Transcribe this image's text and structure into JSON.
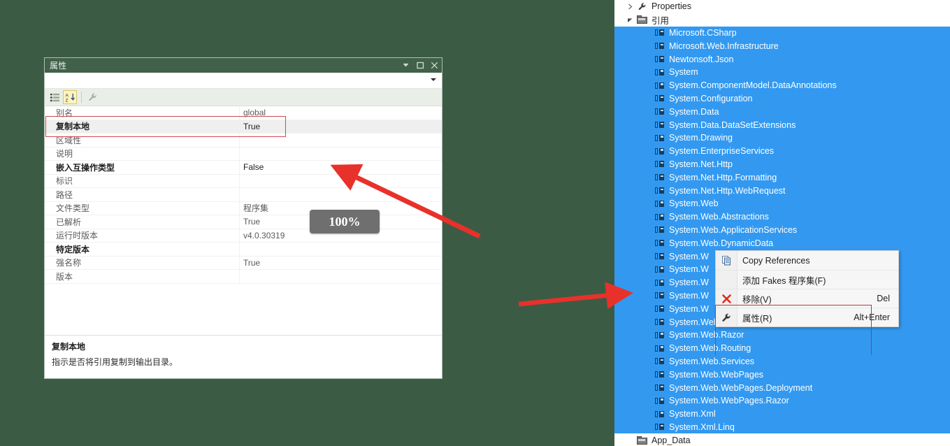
{
  "desktop": {
    "background": "#3c5b45"
  },
  "properties_window": {
    "title": "属性",
    "titlebar_buttons": [
      {
        "name": "dropdown",
        "glyph": "▾"
      },
      {
        "name": "maximize",
        "glyph": "❐"
      },
      {
        "name": "close",
        "glyph": "✕"
      }
    ],
    "toolbar": {
      "categorized_label": "按分类顺序",
      "alphabetical_label": "按字母顺序",
      "property_pages_label": "属性页"
    },
    "grid": {
      "rows": [
        {
          "name": "别名",
          "value": "global",
          "bold": false,
          "selected": false
        },
        {
          "name": "复制本地",
          "value": "True",
          "bold": true,
          "selected": true
        },
        {
          "name": "区域性",
          "value": "",
          "bold": false,
          "selected": false
        },
        {
          "name": "说明",
          "value": "",
          "bold": false,
          "selected": false
        },
        {
          "name": "嵌入互操作类型",
          "value": "False",
          "bold": true,
          "selected": false
        },
        {
          "name": "标识",
          "value": "",
          "bold": false,
          "selected": false
        },
        {
          "name": "路径",
          "value": "",
          "bold": false,
          "selected": false
        },
        {
          "name": "文件类型",
          "value": "程序集",
          "bold": false,
          "selected": false
        },
        {
          "name": "已解析",
          "value": "True",
          "bold": false,
          "selected": false
        },
        {
          "name": "运行时版本",
          "value": "v4.0.30319",
          "bold": false,
          "selected": false
        },
        {
          "name": "特定版本",
          "value": "",
          "bold": true,
          "selected": false
        },
        {
          "name": "强名称",
          "value": "True",
          "bold": false,
          "selected": false
        },
        {
          "name": "版本",
          "value": "",
          "bold": false,
          "selected": false
        }
      ]
    },
    "description": {
      "title": "复制本地",
      "body": "指示是否将引用复制到输出目录。"
    }
  },
  "solution_tree": {
    "nodes": [
      {
        "label": "Properties",
        "level": 1,
        "icon": "wrench-icon",
        "expander": "collapsed",
        "selected": false
      },
      {
        "label": "引用",
        "level": 1,
        "icon": "folder-icon",
        "expander": "expanded",
        "selected": false
      },
      {
        "label": "Microsoft.CSharp",
        "level": 2,
        "icon": "assembly-icon",
        "expander": "none",
        "selected": true
      },
      {
        "label": "Microsoft.Web.Infrastructure",
        "level": 2,
        "icon": "assembly-icon",
        "expander": "none",
        "selected": true
      },
      {
        "label": "Newtonsoft.Json",
        "level": 2,
        "icon": "assembly-icon",
        "expander": "none",
        "selected": true
      },
      {
        "label": "System",
        "level": 2,
        "icon": "assembly-icon",
        "expander": "none",
        "selected": true
      },
      {
        "label": "System.ComponentModel.DataAnnotations",
        "level": 2,
        "icon": "assembly-icon",
        "expander": "none",
        "selected": true
      },
      {
        "label": "System.Configuration",
        "level": 2,
        "icon": "assembly-icon",
        "expander": "none",
        "selected": true
      },
      {
        "label": "System.Data",
        "level": 2,
        "icon": "assembly-icon",
        "expander": "none",
        "selected": true
      },
      {
        "label": "System.Data.DataSetExtensions",
        "level": 2,
        "icon": "assembly-icon",
        "expander": "none",
        "selected": true
      },
      {
        "label": "System.Drawing",
        "level": 2,
        "icon": "assembly-icon",
        "expander": "none",
        "selected": true
      },
      {
        "label": "System.EnterpriseServices",
        "level": 2,
        "icon": "assembly-icon",
        "expander": "none",
        "selected": true
      },
      {
        "label": "System.Net.Http",
        "level": 2,
        "icon": "assembly-icon",
        "expander": "none",
        "selected": true
      },
      {
        "label": "System.Net.Http.Formatting",
        "level": 2,
        "icon": "assembly-icon",
        "expander": "none",
        "selected": true
      },
      {
        "label": "System.Net.Http.WebRequest",
        "level": 2,
        "icon": "assembly-icon",
        "expander": "none",
        "selected": true
      },
      {
        "label": "System.Web",
        "level": 2,
        "icon": "assembly-icon",
        "expander": "none",
        "selected": true
      },
      {
        "label": "System.Web.Abstractions",
        "level": 2,
        "icon": "assembly-icon",
        "expander": "none",
        "selected": true
      },
      {
        "label": "System.Web.ApplicationServices",
        "level": 2,
        "icon": "assembly-icon",
        "expander": "none",
        "selected": true
      },
      {
        "label": "System.Web.DynamicData",
        "level": 2,
        "icon": "assembly-icon",
        "expander": "none",
        "selected": true
      },
      {
        "label": "System.W",
        "level": 2,
        "icon": "assembly-icon",
        "expander": "none",
        "selected": true
      },
      {
        "label": "System.W",
        "level": 2,
        "icon": "assembly-icon",
        "expander": "none",
        "selected": true
      },
      {
        "label": "System.W",
        "level": 2,
        "icon": "assembly-icon",
        "expander": "none",
        "selected": true
      },
      {
        "label": "System.W",
        "level": 2,
        "icon": "assembly-icon",
        "expander": "none",
        "selected": true
      },
      {
        "label": "System.W",
        "level": 2,
        "icon": "assembly-icon",
        "expander": "none",
        "selected": true
      },
      {
        "label": "System.Web.Mvc",
        "level": 2,
        "icon": "assembly-icon",
        "expander": "none",
        "selected": true
      },
      {
        "label": "System.Web.Razor",
        "level": 2,
        "icon": "assembly-icon",
        "expander": "none",
        "selected": true
      },
      {
        "label": "System.Web.Routing",
        "level": 2,
        "icon": "assembly-icon",
        "expander": "none",
        "selected": true
      },
      {
        "label": "System.Web.Services",
        "level": 2,
        "icon": "assembly-icon",
        "expander": "none",
        "selected": true
      },
      {
        "label": "System.Web.WebPages",
        "level": 2,
        "icon": "assembly-icon",
        "expander": "none",
        "selected": true
      },
      {
        "label": "System.Web.WebPages.Deployment",
        "level": 2,
        "icon": "assembly-icon",
        "expander": "none",
        "selected": true
      },
      {
        "label": "System.Web.WebPages.Razor",
        "level": 2,
        "icon": "assembly-icon",
        "expander": "none",
        "selected": true
      },
      {
        "label": "System.Xml",
        "level": 2,
        "icon": "assembly-icon",
        "expander": "none",
        "selected": true
      },
      {
        "label": "System.Xml.Linq",
        "level": 2,
        "icon": "assembly-icon",
        "expander": "none",
        "selected": true
      },
      {
        "label": "App_Data",
        "level": 1,
        "icon": "folder-icon",
        "expander": "none",
        "selected": false
      }
    ],
    "selection_color": "#3399f0"
  },
  "context_menu": {
    "items": [
      {
        "label": "Copy References",
        "accel": "",
        "icon": "copy-icon"
      },
      {
        "label": "添加 Fakes 程序集(F)",
        "accel": "",
        "icon": "none"
      },
      {
        "label": "移除(V)",
        "accel": "Del",
        "icon": "remove-x-icon"
      },
      {
        "label": "属性(R)",
        "accel": "Alt+Enter",
        "icon": "wrench-icon"
      }
    ]
  },
  "annotations": {
    "zoom_badge": "100%",
    "highlight_color": "#d04a52",
    "arrow_color": "#e8312a"
  }
}
